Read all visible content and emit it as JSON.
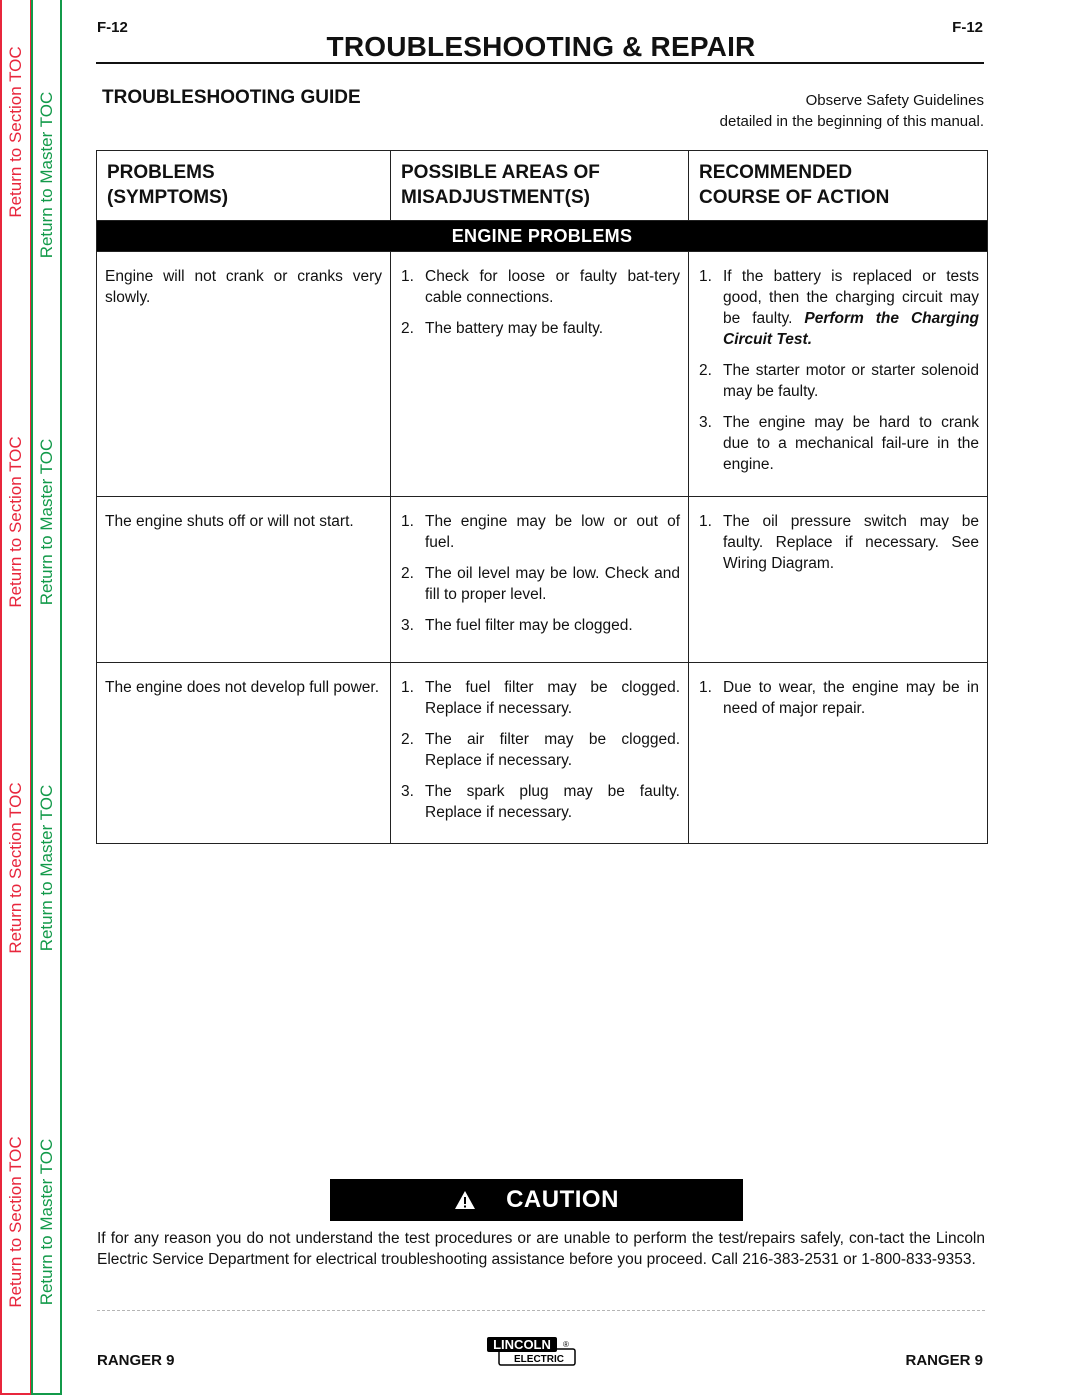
{
  "sidebar": {
    "section_toc_label": "Return to Section TOC",
    "master_toc_label": "Return to Master TOC",
    "section_color": "#e8263c",
    "master_color": "#139a4a"
  },
  "header": {
    "page_number": "F-12",
    "title": "TROUBLESHOOTING & REPAIR"
  },
  "guide": {
    "title": "TROUBLESHOOTING GUIDE",
    "safety_line1": "Observe Safety Guidelines",
    "safety_line2": "detailed in the beginning of this manual."
  },
  "table": {
    "columns": [
      {
        "line1": "PROBLEMS",
        "line2": "(SYMPTOMS)"
      },
      {
        "line1": "POSSIBLE AREAS OF",
        "line2": "MISADJUSTMENT(S)"
      },
      {
        "line1": "RECOMMENDED",
        "line2": "COURSE OF ACTION"
      }
    ],
    "section_title": "ENGINE PROBLEMS",
    "rows": [
      {
        "symptom": "Engine will not crank or cranks very slowly.",
        "causes": [
          {
            "num": "1.",
            "text": "Check for loose or faulty bat-tery cable connections."
          },
          {
            "num": "2.",
            "text": "The battery may be faulty."
          }
        ],
        "actions": [
          {
            "num": "1.",
            "text": "If the battery is replaced or tests good, then the charging circuit may be faulty. ",
            "emphasis": "Perform the Charging Circuit Test."
          },
          {
            "num": "2.",
            "text": "The starter motor or starter solenoid may be faulty."
          },
          {
            "num": "3.",
            "text": "The engine may be hard to crank due to a mechanical fail-ure in the engine."
          }
        ]
      },
      {
        "symptom": "The engine shuts off or will not start.",
        "causes": [
          {
            "num": "1.",
            "text": "The engine may be low or out of fuel."
          },
          {
            "num": "2.",
            "text": "The oil level may be low. Check and fill to proper level."
          },
          {
            "num": "3.",
            "text": "The fuel filter may be clogged."
          }
        ],
        "actions": [
          {
            "num": "1.",
            "text": "The oil pressure switch may be faulty. Replace if necessary. See Wiring Diagram."
          }
        ]
      },
      {
        "symptom": "The engine does not develop full power.",
        "causes": [
          {
            "num": "1.",
            "text": "The fuel filter may be clogged. Replace if necessary."
          },
          {
            "num": "2.",
            "text": "The air filter may be clogged. Replace if necessary."
          },
          {
            "num": "3.",
            "text": "The spark plug may be faulty. Replace if necessary."
          }
        ],
        "actions": [
          {
            "num": "1.",
            "text": "Due to wear, the engine may be in need of major repair."
          }
        ]
      }
    ]
  },
  "caution": {
    "icon": "warning-triangle-icon",
    "label": "CAUTION",
    "text": "If for any reason you do not understand the test procedures or are unable to perform the test/repairs safely, con-tact the Lincoln Electric Service Department for electrical troubleshooting assistance before you proceed.  Call 216-383-2531 or 1-800-833-9353."
  },
  "footer": {
    "model_left": "RANGER 9",
    "model_right": "RANGER 9",
    "logo_top": "LINCOLN",
    "logo_bottom": "ELECTRIC",
    "logo_mark": "®"
  }
}
